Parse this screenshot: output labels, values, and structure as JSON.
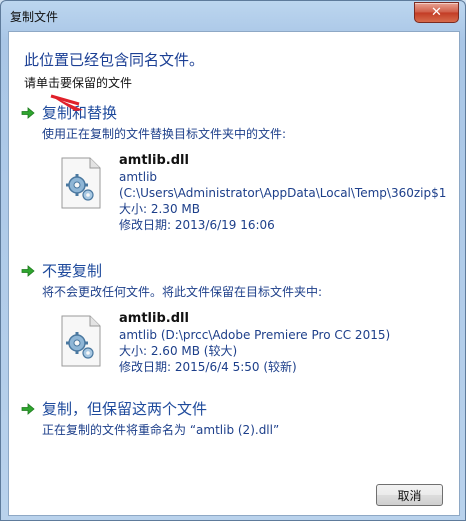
{
  "window": {
    "title": "复制文件",
    "close_glyph": "✕"
  },
  "header": {
    "title": "此位置已经包含同名文件。",
    "subtitle": "请单击要保留的文件"
  },
  "options": [
    {
      "title": "复制和替换",
      "description": "使用正在复制的文件替换目标文件夹中的文件:",
      "file": {
        "name": "amtlib.dll",
        "location_line1": "amtlib",
        "location_line2": "(C:\\Users\\Administrator\\AppData\\Local\\Temp\\360zip$1",
        "size": "大小: 2.30 MB",
        "modified": "修改日期: 2013/6/19 16:06"
      }
    },
    {
      "title": "不要复制",
      "description": "将不会更改任何文件。将此文件保留在目标文件夹中:",
      "file": {
        "name": "amtlib.dll",
        "location_line1": "amtlib (D:\\prcc\\Adobe Premiere Pro CC 2015)",
        "size": "大小: 2.60 MB (较大)",
        "modified": "修改日期: 2015/6/4 5:50 (较新)"
      }
    },
    {
      "title": "复制，但保留这两个文件",
      "description": "正在复制的文件将重命名为 “amtlib (2).dll”"
    }
  ],
  "footer": {
    "cancel_label": "取消"
  },
  "colors": {
    "heading": "#1b3f94",
    "arrow": "#2fa52f",
    "annotation_arrow": "#e0202a"
  },
  "icons": {
    "option_arrow": "green-arrow-icon",
    "file": "dll-file-gear-icon",
    "close": "close-icon"
  }
}
